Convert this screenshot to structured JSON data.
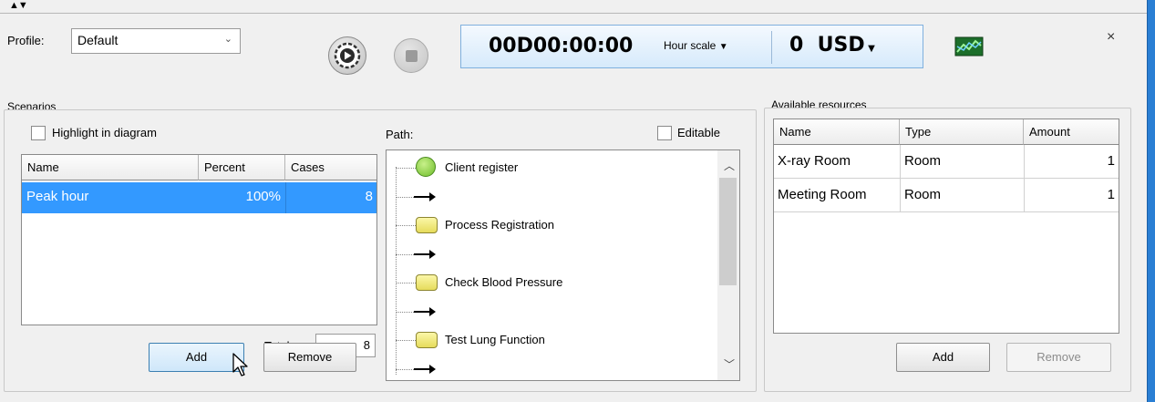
{
  "toolbar": {
    "collapse_glyph": "▲▼",
    "profile_label": "Profile:",
    "profile_value": "Default",
    "clock": "00D00:00:00",
    "scale_label": "Hour scale",
    "cost_value": "0",
    "currency": "USD",
    "close_glyph": "×"
  },
  "scenarios": {
    "title": "Scenarios",
    "highlight_label": "Highlight in diagram",
    "columns": [
      "Name",
      "Percent",
      "Cases"
    ],
    "rows": [
      {
        "name": "Peak hour",
        "percent": "100%",
        "cases": "8"
      }
    ],
    "total_label": "Total:",
    "total_value": "8",
    "add_label": "Add",
    "remove_label": "Remove"
  },
  "path": {
    "title": "Path:",
    "editable_label": "Editable",
    "nodes": [
      "Client register",
      "Process Registration",
      "Check Blood Pressure",
      "Test Lung Function"
    ]
  },
  "resources": {
    "title": "Available resources",
    "columns": [
      "Name",
      "Type",
      "Amount"
    ],
    "rows": [
      {
        "name": "X-ray Room",
        "type": "Room",
        "amount": "1"
      },
      {
        "name": "Meeting Room",
        "type": "Room",
        "amount": "1"
      }
    ],
    "add_label": "Add",
    "remove_label": "Remove"
  },
  "colors": {
    "selection": "#3399ff",
    "accent_bar": "#2a7fd4",
    "start_node": "#6ebd2a",
    "task_node": "#e6dc5c"
  },
  "icons": {
    "play": "play-icon",
    "stop": "stop-icon",
    "chart": "chart-icon",
    "close": "close-icon"
  }
}
